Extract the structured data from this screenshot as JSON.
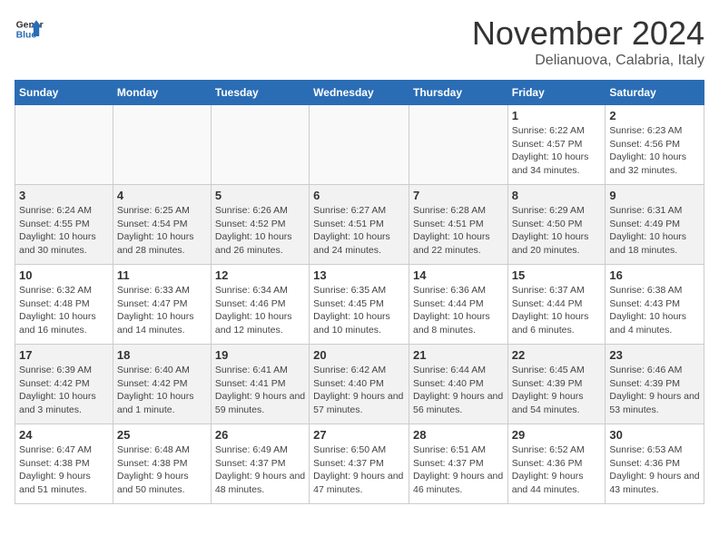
{
  "header": {
    "logo_line1": "General",
    "logo_line2": "Blue",
    "month": "November 2024",
    "location": "Delianuova, Calabria, Italy"
  },
  "weekdays": [
    "Sunday",
    "Monday",
    "Tuesday",
    "Wednesday",
    "Thursday",
    "Friday",
    "Saturday"
  ],
  "weeks": [
    [
      {
        "day": "",
        "info": ""
      },
      {
        "day": "",
        "info": ""
      },
      {
        "day": "",
        "info": ""
      },
      {
        "day": "",
        "info": ""
      },
      {
        "day": "",
        "info": ""
      },
      {
        "day": "1",
        "info": "Sunrise: 6:22 AM\nSunset: 4:57 PM\nDaylight: 10 hours and 34 minutes."
      },
      {
        "day": "2",
        "info": "Sunrise: 6:23 AM\nSunset: 4:56 PM\nDaylight: 10 hours and 32 minutes."
      }
    ],
    [
      {
        "day": "3",
        "info": "Sunrise: 6:24 AM\nSunset: 4:55 PM\nDaylight: 10 hours and 30 minutes."
      },
      {
        "day": "4",
        "info": "Sunrise: 6:25 AM\nSunset: 4:54 PM\nDaylight: 10 hours and 28 minutes."
      },
      {
        "day": "5",
        "info": "Sunrise: 6:26 AM\nSunset: 4:52 PM\nDaylight: 10 hours and 26 minutes."
      },
      {
        "day": "6",
        "info": "Sunrise: 6:27 AM\nSunset: 4:51 PM\nDaylight: 10 hours and 24 minutes."
      },
      {
        "day": "7",
        "info": "Sunrise: 6:28 AM\nSunset: 4:51 PM\nDaylight: 10 hours and 22 minutes."
      },
      {
        "day": "8",
        "info": "Sunrise: 6:29 AM\nSunset: 4:50 PM\nDaylight: 10 hours and 20 minutes."
      },
      {
        "day": "9",
        "info": "Sunrise: 6:31 AM\nSunset: 4:49 PM\nDaylight: 10 hours and 18 minutes."
      }
    ],
    [
      {
        "day": "10",
        "info": "Sunrise: 6:32 AM\nSunset: 4:48 PM\nDaylight: 10 hours and 16 minutes."
      },
      {
        "day": "11",
        "info": "Sunrise: 6:33 AM\nSunset: 4:47 PM\nDaylight: 10 hours and 14 minutes."
      },
      {
        "day": "12",
        "info": "Sunrise: 6:34 AM\nSunset: 4:46 PM\nDaylight: 10 hours and 12 minutes."
      },
      {
        "day": "13",
        "info": "Sunrise: 6:35 AM\nSunset: 4:45 PM\nDaylight: 10 hours and 10 minutes."
      },
      {
        "day": "14",
        "info": "Sunrise: 6:36 AM\nSunset: 4:44 PM\nDaylight: 10 hours and 8 minutes."
      },
      {
        "day": "15",
        "info": "Sunrise: 6:37 AM\nSunset: 4:44 PM\nDaylight: 10 hours and 6 minutes."
      },
      {
        "day": "16",
        "info": "Sunrise: 6:38 AM\nSunset: 4:43 PM\nDaylight: 10 hours and 4 minutes."
      }
    ],
    [
      {
        "day": "17",
        "info": "Sunrise: 6:39 AM\nSunset: 4:42 PM\nDaylight: 10 hours and 3 minutes."
      },
      {
        "day": "18",
        "info": "Sunrise: 6:40 AM\nSunset: 4:42 PM\nDaylight: 10 hours and 1 minute."
      },
      {
        "day": "19",
        "info": "Sunrise: 6:41 AM\nSunset: 4:41 PM\nDaylight: 9 hours and 59 minutes."
      },
      {
        "day": "20",
        "info": "Sunrise: 6:42 AM\nSunset: 4:40 PM\nDaylight: 9 hours and 57 minutes."
      },
      {
        "day": "21",
        "info": "Sunrise: 6:44 AM\nSunset: 4:40 PM\nDaylight: 9 hours and 56 minutes."
      },
      {
        "day": "22",
        "info": "Sunrise: 6:45 AM\nSunset: 4:39 PM\nDaylight: 9 hours and 54 minutes."
      },
      {
        "day": "23",
        "info": "Sunrise: 6:46 AM\nSunset: 4:39 PM\nDaylight: 9 hours and 53 minutes."
      }
    ],
    [
      {
        "day": "24",
        "info": "Sunrise: 6:47 AM\nSunset: 4:38 PM\nDaylight: 9 hours and 51 minutes."
      },
      {
        "day": "25",
        "info": "Sunrise: 6:48 AM\nSunset: 4:38 PM\nDaylight: 9 hours and 50 minutes."
      },
      {
        "day": "26",
        "info": "Sunrise: 6:49 AM\nSunset: 4:37 PM\nDaylight: 9 hours and 48 minutes."
      },
      {
        "day": "27",
        "info": "Sunrise: 6:50 AM\nSunset: 4:37 PM\nDaylight: 9 hours and 47 minutes."
      },
      {
        "day": "28",
        "info": "Sunrise: 6:51 AM\nSunset: 4:37 PM\nDaylight: 9 hours and 46 minutes."
      },
      {
        "day": "29",
        "info": "Sunrise: 6:52 AM\nSunset: 4:36 PM\nDaylight: 9 hours and 44 minutes."
      },
      {
        "day": "30",
        "info": "Sunrise: 6:53 AM\nSunset: 4:36 PM\nDaylight: 9 hours and 43 minutes."
      }
    ]
  ]
}
